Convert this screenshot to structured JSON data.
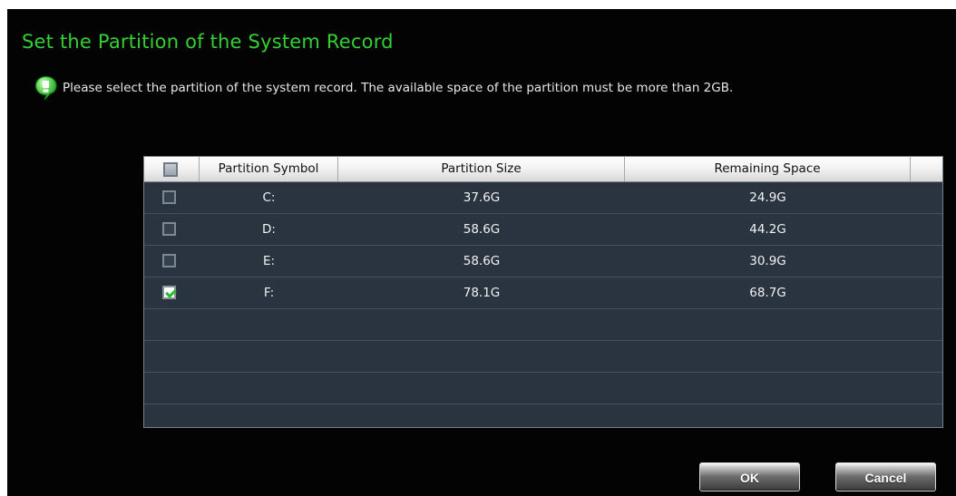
{
  "dialog": {
    "title": "Set the Partition of the System Record",
    "info_icon": "info-bubble-icon",
    "info_text": "Please select the partition of the system record. The available space of the partition must be more than 2GB."
  },
  "table": {
    "columns": [
      "Partition Symbol",
      "Partition Size",
      "Remaining Space"
    ],
    "rows": [
      {
        "symbol": "C:",
        "size": "37.6G",
        "remaining": "24.9G",
        "checked": false
      },
      {
        "symbol": "D:",
        "size": "58.6G",
        "remaining": "44.2G",
        "checked": false
      },
      {
        "symbol": "E:",
        "size": "58.6G",
        "remaining": "30.9G",
        "checked": false
      },
      {
        "symbol": "F:",
        "size": "78.1G",
        "remaining": "68.7G",
        "checked": true
      }
    ]
  },
  "buttons": {
    "ok": "OK",
    "cancel": "Cancel"
  },
  "colors": {
    "title": "#32d232",
    "dialog_background": "#030303",
    "grid_background": "#2a3440",
    "check": "#27bd27"
  }
}
